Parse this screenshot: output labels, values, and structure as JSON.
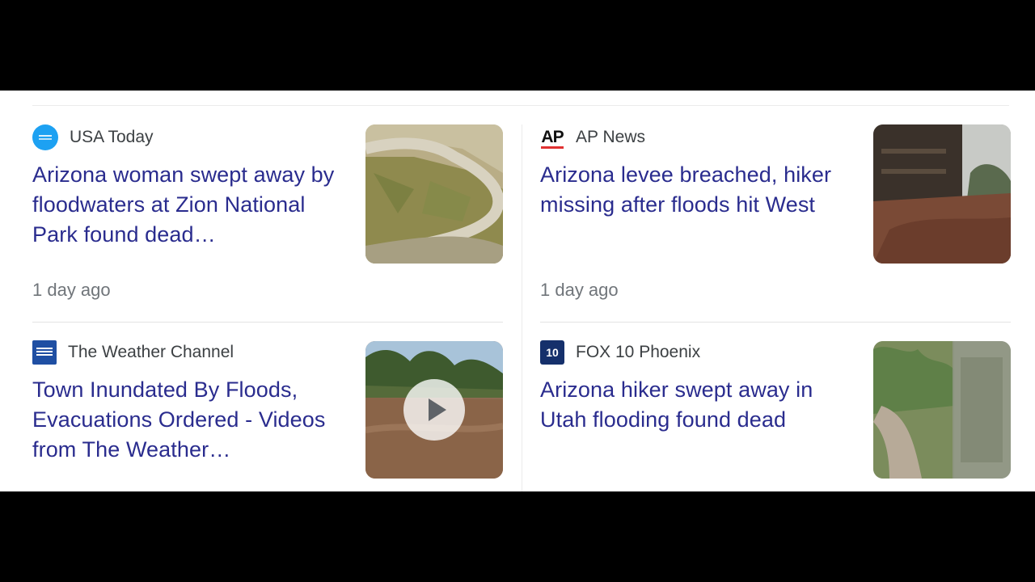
{
  "cards": [
    {
      "source": "USA Today",
      "source_icon": "usa-today-logo-icon",
      "headline": "Arizona woman swept away by floodwaters at Zion National Park found dead…",
      "time": "1 day ago"
    },
    {
      "source": "AP News",
      "source_icon": "ap-logo-icon",
      "logo_text": "AP",
      "headline": "Arizona levee breached, hiker missing after floods hit West",
      "time": "1 day ago"
    },
    {
      "source": "The Weather Channel",
      "source_icon": "weather-channel-logo-icon",
      "headline": "Town Inundated By Floods, Evacuations Ordered - Videos from The Weather…",
      "time": ""
    },
    {
      "source": "FOX 10 Phoenix",
      "source_icon": "fox10-logo-icon",
      "logo_text": "10",
      "headline": "Arizona hiker swept away in Utah flooding found dead",
      "time": ""
    }
  ],
  "colors": {
    "headline": "#2a2c8e",
    "source": "#3c4043",
    "time": "#70757a",
    "divider": "#ebebeb",
    "letterbox": "#000000"
  }
}
